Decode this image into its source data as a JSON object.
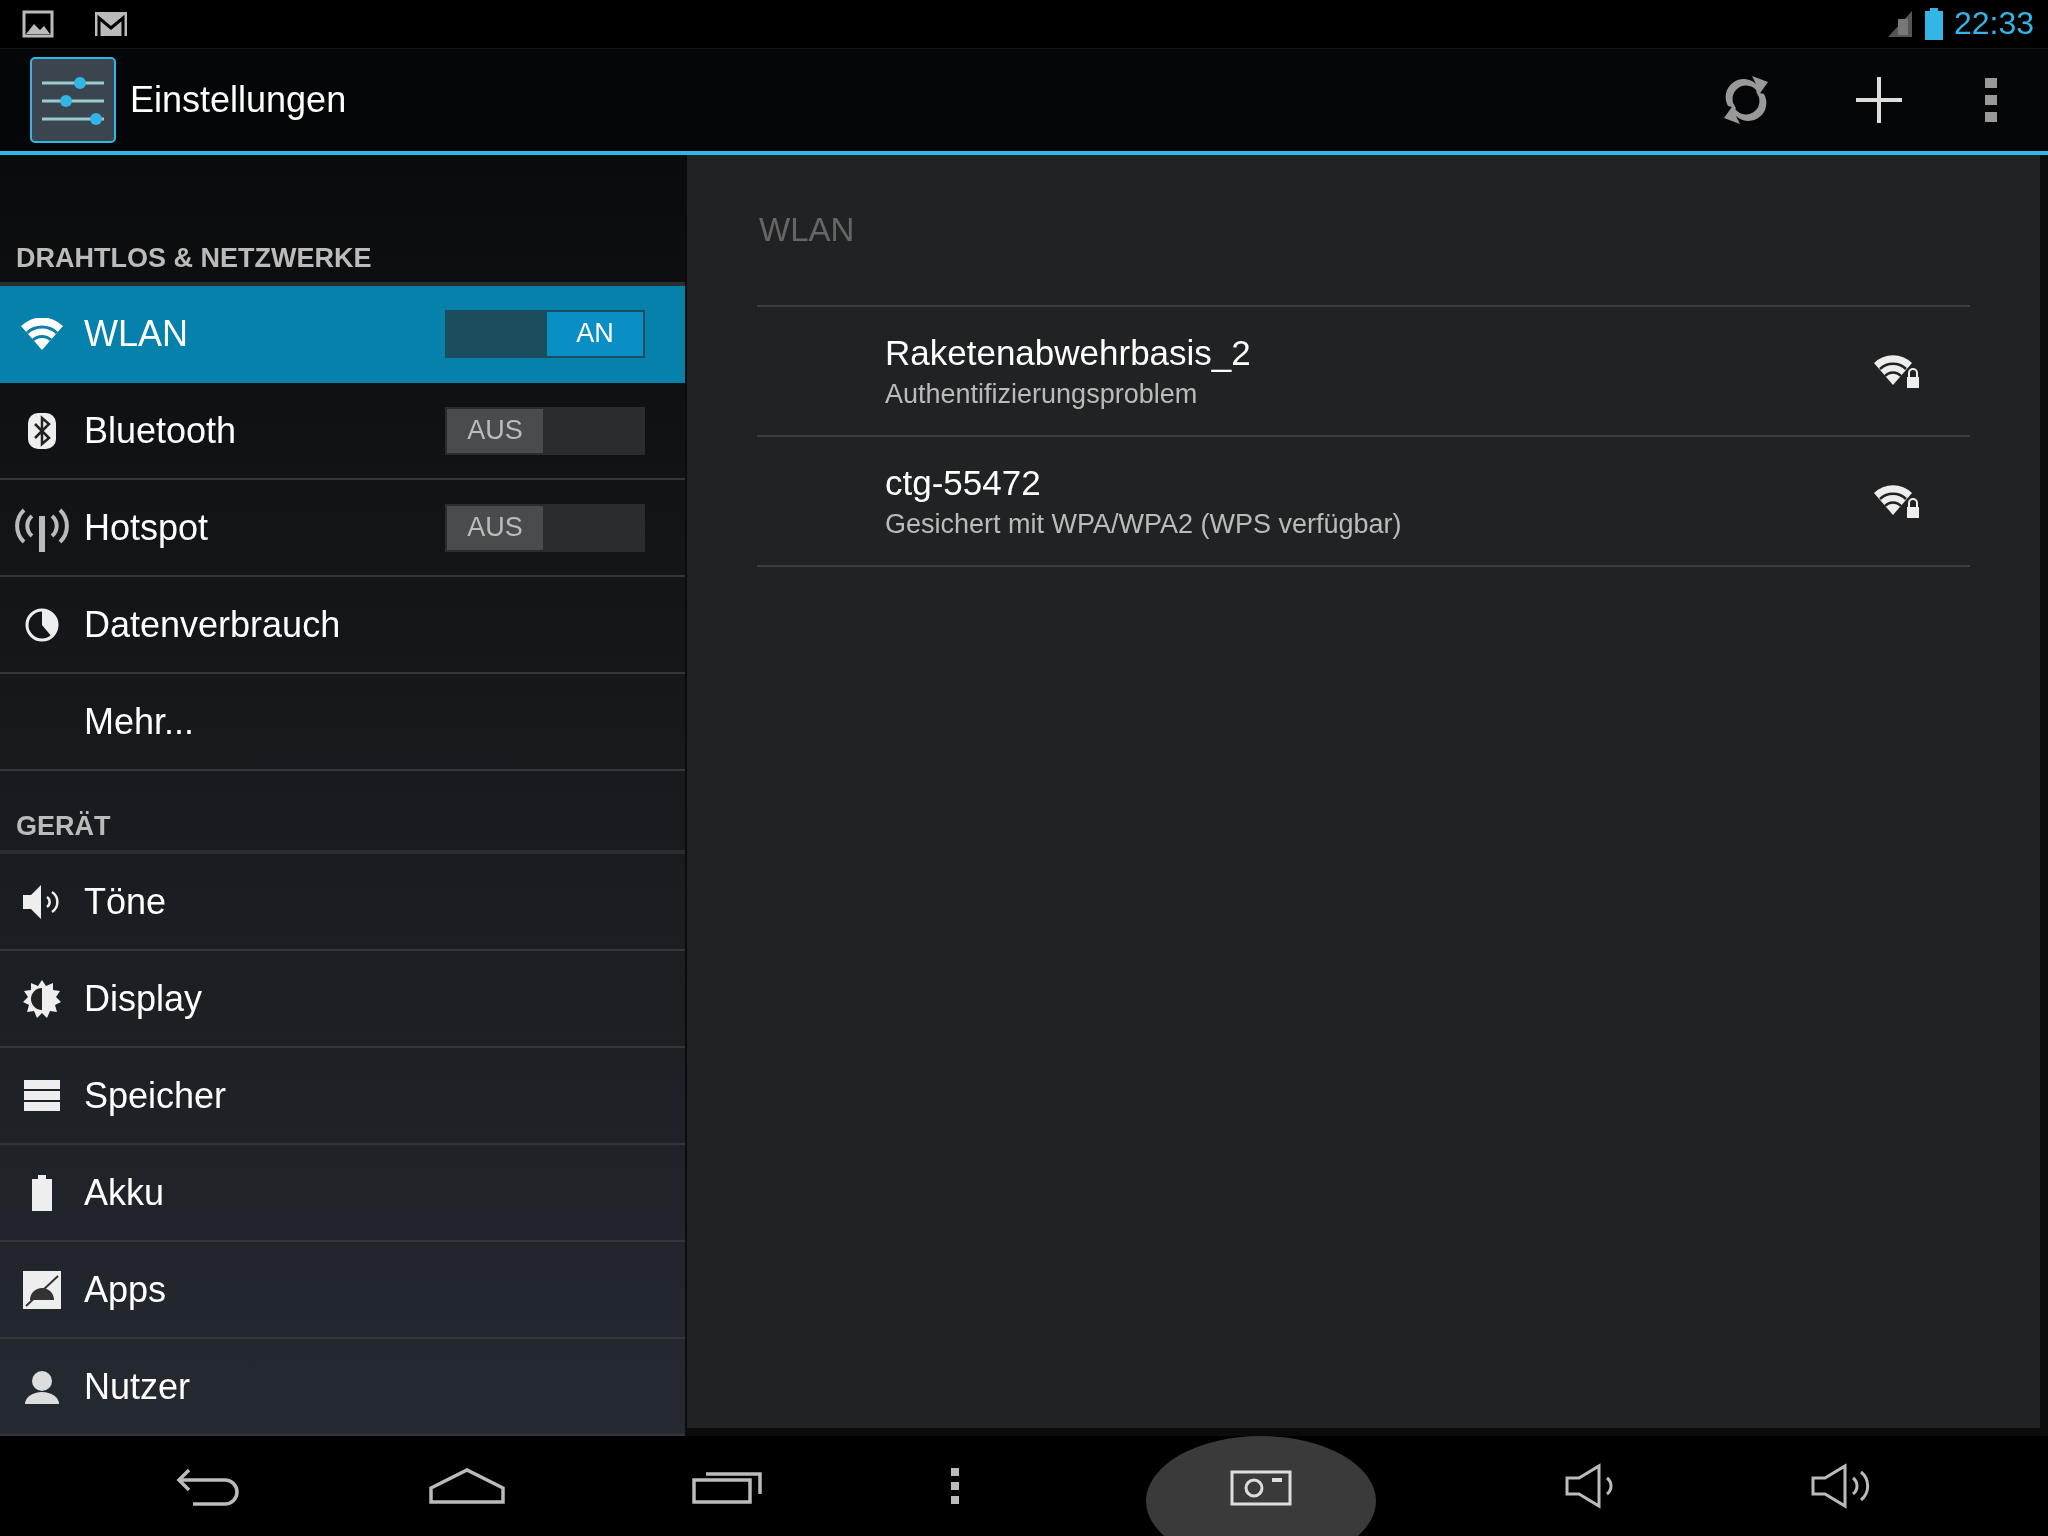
{
  "status_bar": {
    "time": "22:33"
  },
  "action_bar": {
    "title": "Einstellungen"
  },
  "sidebar": {
    "sections": [
      {
        "header": "DRAHTLOS & NETZWERKE",
        "items": [
          {
            "label": "WLAN",
            "selected": true,
            "kind": "toggle",
            "on": true,
            "toggle_label": "AN"
          },
          {
            "label": "Bluetooth",
            "selected": false,
            "kind": "toggle",
            "on": false,
            "toggle_label": "AUS"
          },
          {
            "label": "Hotspot",
            "selected": false,
            "kind": "toggle",
            "on": false,
            "toggle_label": "AUS"
          },
          {
            "label": "Datenverbrauch",
            "selected": false,
            "kind": "plain"
          },
          {
            "label": "Mehr...",
            "selected": false,
            "kind": "plain"
          }
        ]
      },
      {
        "header": "GERÄT",
        "items": [
          {
            "label": "Töne",
            "selected": false,
            "kind": "plain"
          },
          {
            "label": "Display",
            "selected": false,
            "kind": "plain"
          },
          {
            "label": "Speicher",
            "selected": false,
            "kind": "plain"
          },
          {
            "label": "Akku",
            "selected": false,
            "kind": "plain"
          },
          {
            "label": "Apps",
            "selected": false,
            "kind": "plain"
          },
          {
            "label": "Nutzer",
            "selected": false,
            "kind": "plain"
          }
        ]
      }
    ]
  },
  "panel": {
    "title": "WLAN",
    "networks": [
      {
        "ssid": "Raketenabwehrbasis_2",
        "status": "Authentifizierungsproblem"
      },
      {
        "ssid": "ctg-55472",
        "status": "Gesichert mit WPA/WPA2 (WPS verfügbar)"
      }
    ]
  }
}
